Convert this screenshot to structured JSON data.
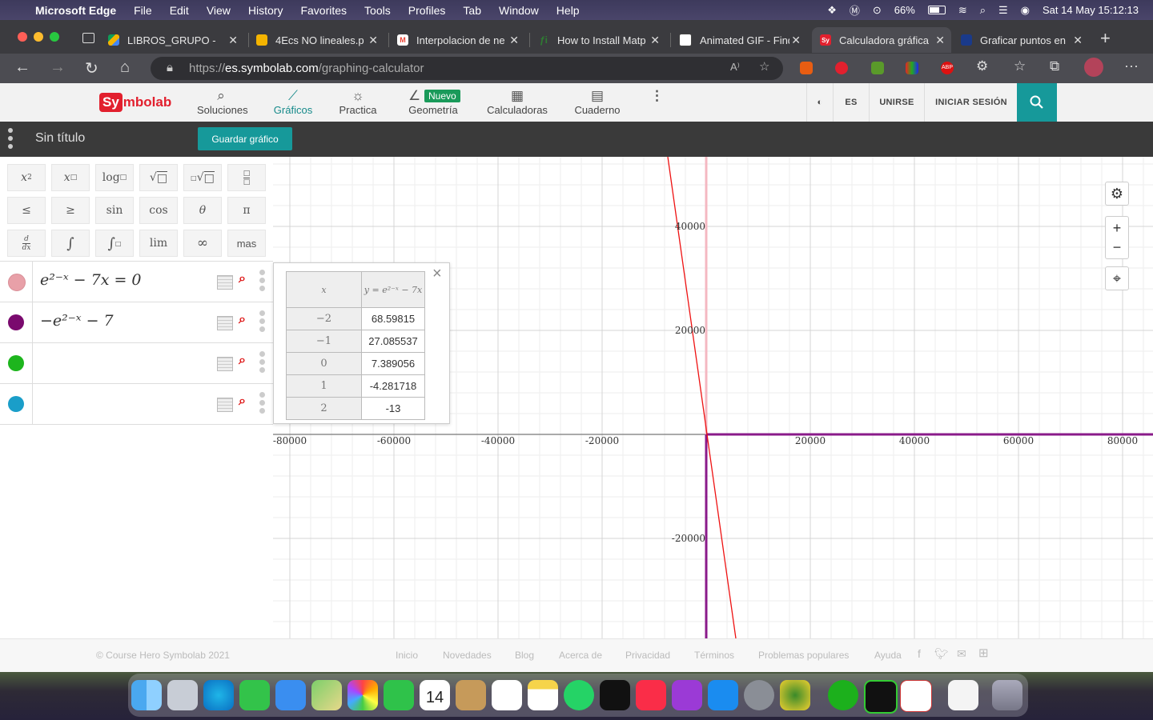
{
  "menubar": {
    "app": "Microsoft Edge",
    "items": [
      "File",
      "Edit",
      "View",
      "History",
      "Favorites",
      "Tools",
      "Profiles",
      "Tab",
      "Window",
      "Help"
    ],
    "battery": "66%",
    "datetime": "Sat 14 May  15:12:13"
  },
  "tabs": [
    {
      "title": "LIBROS_GRUPO - C",
      "color": "#f4b400"
    },
    {
      "title": "4Ecs NO lineales.p",
      "color": "#f4b400"
    },
    {
      "title": "Interpolacion de ne",
      "color": "#ea4335"
    },
    {
      "title": "How to Install Matp",
      "color": "#2e7d32"
    },
    {
      "title": "Animated GIF - Find",
      "color": "#ffffff"
    },
    {
      "title": "Calculadora gráfica",
      "color": "#e2202e",
      "active": true
    },
    {
      "title": "Graficar puntos en",
      "color": "#1a3a8a"
    }
  ],
  "address": {
    "prefix": "https://",
    "domain": "es.symbolab.com",
    "path": "/graphing-calculator"
  },
  "site": {
    "logo_sy": "Sy",
    "logo_rest": "mbolab",
    "nav": [
      "Soluciones",
      "Gráficos",
      "Practica",
      "Geometría",
      "Calculadoras",
      "Cuaderno"
    ],
    "nuevo": "Nuevo",
    "lang": "ES",
    "join": "UNIRSE",
    "login": "INICIAR SESIÓN"
  },
  "doc": {
    "title": "Sin título",
    "save": "Guardar gráfico"
  },
  "keypad": {
    "row3": {
      "sin": "sin",
      "cos": "cos",
      "theta": "θ",
      "pi": "π",
      "lim": "lim",
      "inf": "∞",
      "mas": "mas"
    },
    "le": "≤",
    "ge": "≥"
  },
  "expressions": [
    {
      "text": "e²⁻ˣ − 7x = 0",
      "color": "#e8a0a8"
    },
    {
      "text": "−e²⁻ˣ − 7",
      "color": "#7a0a6e"
    },
    {
      "text": "",
      "color": "#1db51d"
    },
    {
      "text": "",
      "color": "#1a9ec9"
    }
  ],
  "table": {
    "header_x": "x",
    "header_y": "y = e²⁻ˣ − 7x",
    "rows": [
      {
        "x": "−2",
        "y": "68.59815"
      },
      {
        "x": "−1",
        "y": "27.085537"
      },
      {
        "x": "0",
        "y": "7.389056"
      },
      {
        "x": "1",
        "y": "-4.281718"
      },
      {
        "x": "2",
        "y": "-13"
      }
    ]
  },
  "graph": {
    "x_ticks": [
      "-80000",
      "-60000",
      "-40000",
      "-20000",
      "20000",
      "40000",
      "60000",
      "80000"
    ],
    "y_ticks": [
      "40000",
      "20000",
      "-20000"
    ]
  },
  "footer": {
    "copyright": "© Course Hero Symbolab 2021",
    "links": [
      "Inicio",
      "Novedades",
      "Blog",
      "Acerca de",
      "Privacidad",
      "Términos",
      "Problemas populares",
      "Ayuda"
    ]
  },
  "dock_date": "14"
}
